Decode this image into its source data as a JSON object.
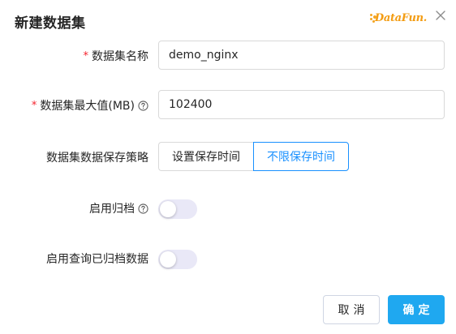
{
  "dialog": {
    "title": "新建数据集",
    "logo_text": "DataFun.",
    "close_icon": "close-icon"
  },
  "form": {
    "name": {
      "label": "数据集名称",
      "required": "*",
      "value": "demo_nginx"
    },
    "max_size": {
      "label": "数据集最大值(MB)",
      "required": "*",
      "value": "102400",
      "help_icon": "question-circle-icon"
    },
    "retention": {
      "label": "数据集数据保存策略",
      "options": [
        "设置保存时间",
        "不限保存时间"
      ],
      "selected": "不限保存时间"
    },
    "archive": {
      "label": "启用归档",
      "help_icon": "question-circle-icon",
      "enabled": false
    },
    "query_archived": {
      "label": "启用查询已归档数据",
      "enabled": false
    }
  },
  "footer": {
    "cancel_label": "取消",
    "ok_label": "确定"
  },
  "colors": {
    "primary": "#1890ff",
    "ok_button": "#1fa8f0",
    "required": "#f5222d",
    "switch_off": "#e9e8f7",
    "logo": "#f39c12"
  }
}
